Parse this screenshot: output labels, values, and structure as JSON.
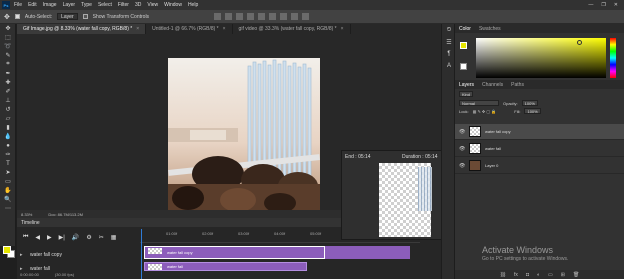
{
  "menubar": {
    "logo": "Ps",
    "items": [
      "File",
      "Edit",
      "Image",
      "Layer",
      "Type",
      "Select",
      "Filter",
      "3D",
      "View",
      "Window",
      "Help"
    ],
    "window_controls": [
      "—",
      "❐",
      "✕"
    ]
  },
  "options": {
    "auto_select_label": "Auto-Select:",
    "auto_select_value": "Layer",
    "show_transform_label": "Show Transform Controls"
  },
  "doc_tabs": [
    {
      "label": "Gif Image.jpg @ 8.33% (water fall copy, RGB/8) *",
      "close": "×"
    },
    {
      "label": "Untitled-1 @ 66.7% (RGB/8) *",
      "close": "×"
    },
    {
      "label": "gif video @ 33.3% (water fall copy, RGB/8) *",
      "close": "×"
    }
  ],
  "status": {
    "zoom": "8.33%",
    "doc": "Doc: 86.7M/113.2M"
  },
  "timeline": {
    "title": "Timeline",
    "controls": [
      "⏮",
      "◀",
      "▶",
      "▶|",
      "🔊",
      "⚙",
      "✂",
      "▦"
    ],
    "ruler_ticks": [
      "01:00f",
      "02:00f",
      "03:00f",
      "04:00f",
      "05:00f",
      "06:00f"
    ],
    "tracks": [
      {
        "label": "water fall copy",
        "clip_label": "water fall copy"
      },
      {
        "label": "water fall",
        "clip_label": "water fall"
      }
    ],
    "footer_time": "0:00:00:00",
    "footer_fps": "(30.00 fps)"
  },
  "duration_popup": {
    "end": "End : 05:14",
    "duration": "Duration : 05:14"
  },
  "color_panel": {
    "tabs": [
      "Color",
      "Swatches"
    ],
    "fg": "#e6e600",
    "bg": "#ffffff"
  },
  "layers_panel": {
    "tabs": [
      "Layers",
      "Channels",
      "Paths"
    ],
    "kind": "Kind",
    "blend": "Normal",
    "opacity_label": "Opacity:",
    "opacity_value": "100%",
    "lock_label": "Lock:",
    "fill_label": "Fill:",
    "fill_value": "100%",
    "layers": [
      {
        "name": "water fall copy",
        "active": true
      },
      {
        "name": "water fall",
        "active": false
      },
      {
        "name": "Layer 0",
        "active": false
      }
    ]
  },
  "watermark": {
    "line1": "Activate Windows",
    "line2": "Go to PC settings to activate Windows."
  }
}
